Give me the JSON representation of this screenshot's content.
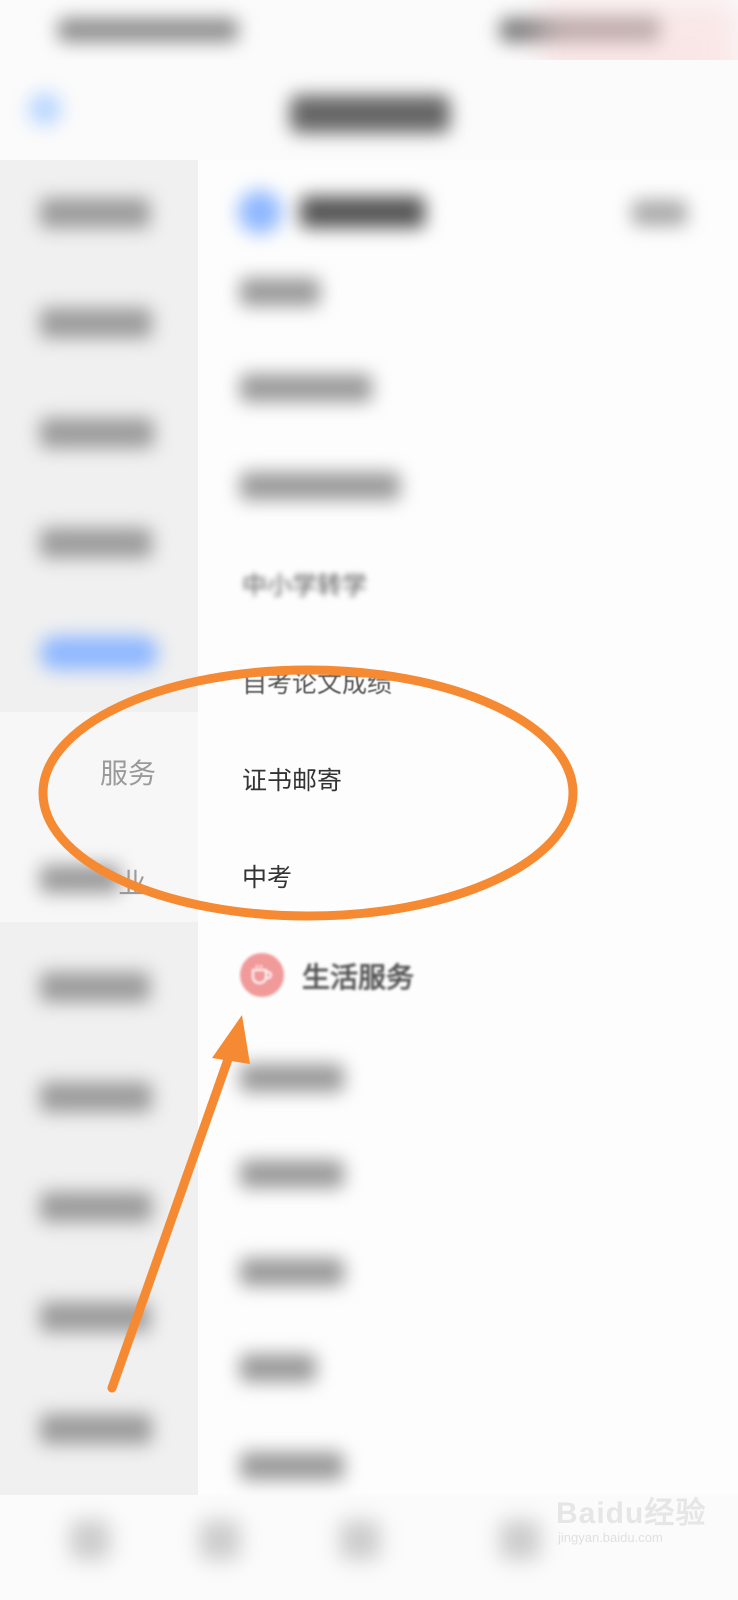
{
  "main": {
    "services": [
      {
        "label": "中小学转学"
      },
      {
        "label": "自考论文成绩"
      },
      {
        "label": "证书邮寄"
      },
      {
        "label": "中考"
      }
    ],
    "life_category": {
      "icon": "coffee-cup-icon",
      "title": "生活服务",
      "color": "#f19a9a"
    }
  },
  "sidebar": {
    "fragments": [
      {
        "label": "服务"
      },
      {
        "label": "业"
      }
    ]
  },
  "watermark": {
    "brand": "Baidu经验",
    "url": "jingyan.baidu.com"
  },
  "colors": {
    "annotation": "#f58a33",
    "accent_blue": "#8fb8ff"
  }
}
